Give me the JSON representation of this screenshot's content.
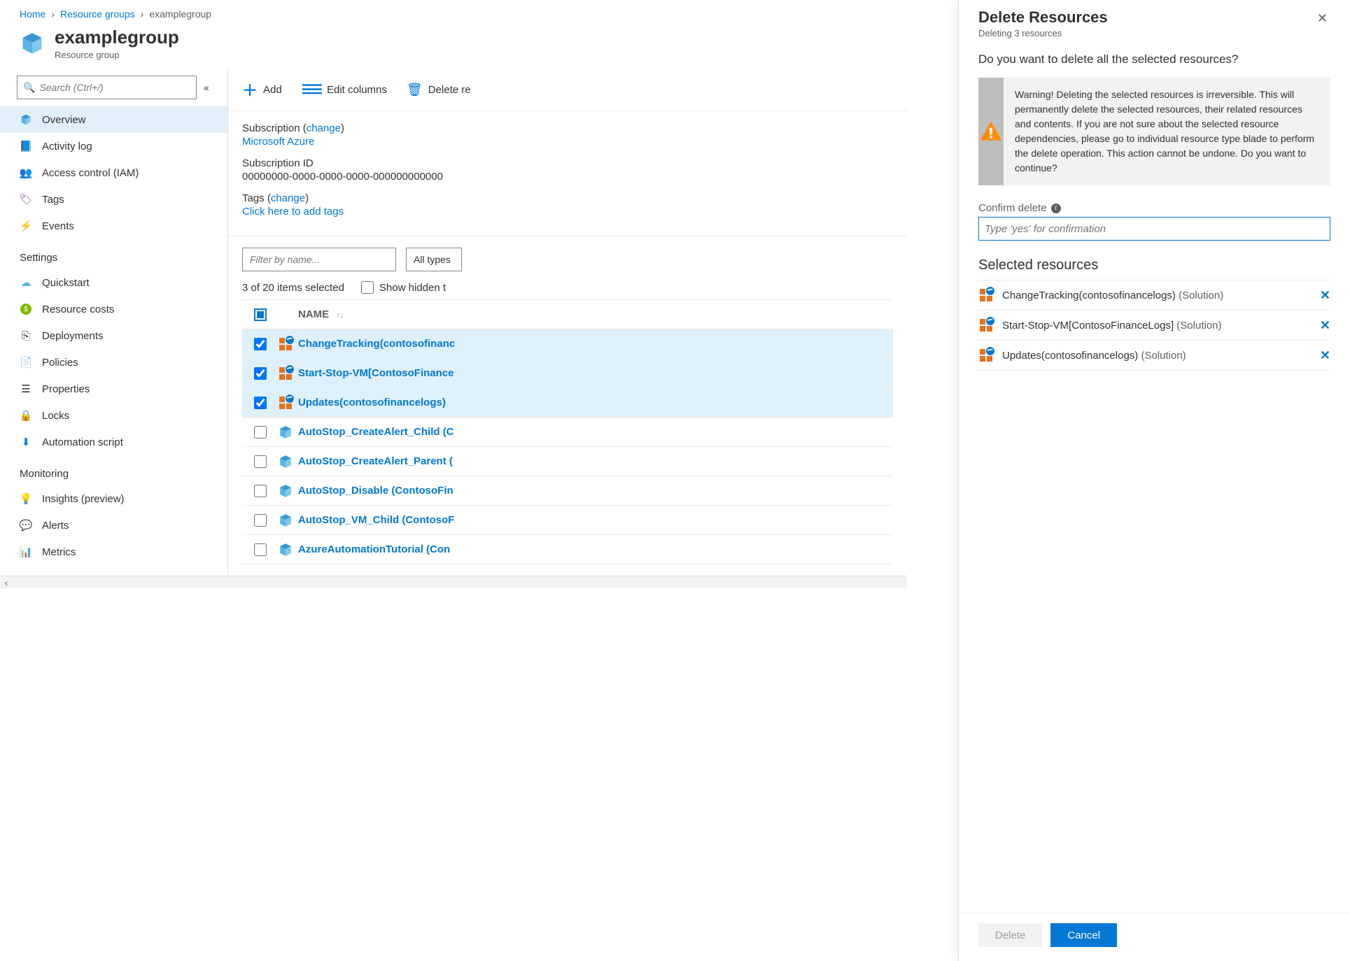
{
  "breadcrumb": {
    "home": "Home",
    "groups": "Resource groups",
    "current": "examplegroup"
  },
  "blade": {
    "title": "examplegroup",
    "subtitle": "Resource group"
  },
  "search": {
    "placeholder": "Search (Ctrl+/)"
  },
  "nav": {
    "primary": [
      {
        "icon": "cube",
        "label": "Overview",
        "active": true
      },
      {
        "icon": "log",
        "label": "Activity log"
      },
      {
        "icon": "iam",
        "label": "Access control (IAM)"
      },
      {
        "icon": "tag",
        "label": "Tags"
      },
      {
        "icon": "bolt",
        "label": "Events"
      }
    ],
    "settings_label": "Settings",
    "settings": [
      {
        "icon": "cloud",
        "label": "Quickstart"
      },
      {
        "icon": "cost",
        "label": "Resource costs"
      },
      {
        "icon": "deploy",
        "label": "Deployments"
      },
      {
        "icon": "policy",
        "label": "Policies"
      },
      {
        "icon": "props",
        "label": "Properties"
      },
      {
        "icon": "lock",
        "label": "Locks"
      },
      {
        "icon": "script",
        "label": "Automation script"
      }
    ],
    "monitoring_label": "Monitoring",
    "monitoring": [
      {
        "icon": "bulb",
        "label": "Insights (preview)"
      },
      {
        "icon": "alert",
        "label": "Alerts"
      },
      {
        "icon": "metrics",
        "label": "Metrics"
      }
    ]
  },
  "toolbar": {
    "add": "Add",
    "edit_columns": "Edit columns",
    "delete": "Delete re"
  },
  "essentials": {
    "sub_label": "Subscription",
    "sub_change": "change",
    "sub_value": "Microsoft Azure",
    "subid_label": "Subscription ID",
    "subid_value": "00000000-0000-0000-0000-000000000000",
    "tags_label": "Tags",
    "tags_change": "change",
    "tags_value": "Click here to add tags"
  },
  "grid": {
    "filter_placeholder": "Filter by name...",
    "types": "All types",
    "count": "3 of 20 items selected",
    "show_hidden": "Show hidden t",
    "name_header": "NAME",
    "rows": [
      {
        "selected": true,
        "icon": "solution",
        "name": "ChangeTracking(contosofinanc"
      },
      {
        "selected": true,
        "icon": "solution",
        "name": "Start-Stop-VM[ContosoFinance"
      },
      {
        "selected": true,
        "icon": "solution",
        "name": "Updates(contosofinancelogs)"
      },
      {
        "selected": false,
        "icon": "runbook",
        "name": "AutoStop_CreateAlert_Child (C"
      },
      {
        "selected": false,
        "icon": "runbook",
        "name": "AutoStop_CreateAlert_Parent ("
      },
      {
        "selected": false,
        "icon": "runbook",
        "name": "AutoStop_Disable (ContosoFin"
      },
      {
        "selected": false,
        "icon": "runbook",
        "name": "AutoStop_VM_Child (ContosoF"
      },
      {
        "selected": false,
        "icon": "runbook",
        "name": "AzureAutomationTutorial (Con"
      }
    ]
  },
  "panel": {
    "title": "Delete Resources",
    "subtitle": "Deleting 3 resources",
    "question": "Do you want to delete all the selected resources?",
    "warning": "Warning! Deleting the selected resources is irreversible. This will permanently delete the selected resources, their related resources and contents. If you are not sure about the selected resource dependencies, please go to individual resource type blade to perform the delete operation. This action cannot be undone. Do you want to continue?",
    "confirm_label": "Confirm delete",
    "confirm_placeholder": "Type 'yes' for confirmation",
    "selected_heading": "Selected resources",
    "selected": [
      {
        "name": "ChangeTracking(contosofinancelogs)",
        "type": "(Solution)"
      },
      {
        "name": "Start-Stop-VM[ContosoFinanceLogs]",
        "type": "(Solution)"
      },
      {
        "name": "Updates(contosofinancelogs)",
        "type": "(Solution)"
      }
    ],
    "delete_btn": "Delete",
    "cancel_btn": "Cancel"
  }
}
